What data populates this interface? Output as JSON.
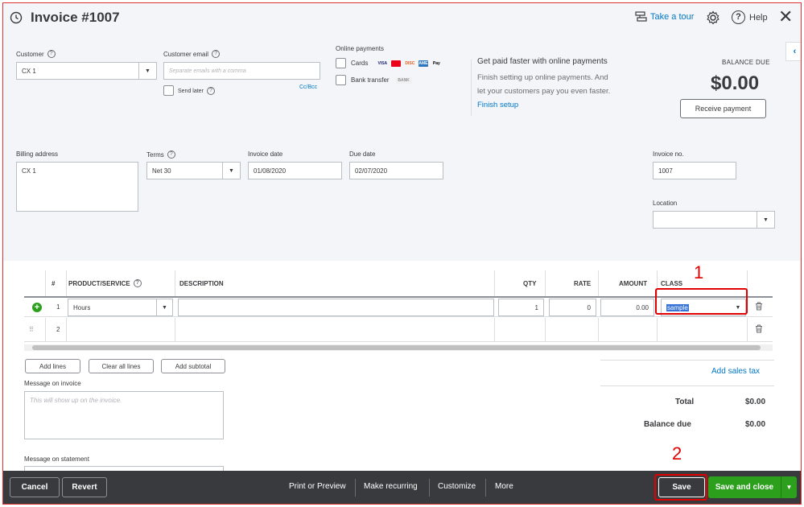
{
  "header": {
    "title": "Invoice #1007",
    "tour_label": "Take a tour",
    "help_label": "Help",
    "help_glyph": "?",
    "close_glyph": "✕"
  },
  "customer": {
    "label": "Customer",
    "value": "CX 1",
    "help_glyph": "?"
  },
  "customer_email": {
    "label": "Customer email",
    "placeholder": "Separate emails with a comma",
    "send_later": "Send later",
    "cc_bcc": "Cc/Bcc"
  },
  "online_payments": {
    "label": "Online payments",
    "cards": "Cards",
    "card_logos": [
      "VISA",
      "MC",
      "DISC",
      "AMEX",
      "Pay"
    ],
    "bank_transfer": "Bank transfer",
    "bank_badge": "BANK"
  },
  "promo": {
    "heading": "Get paid faster with online payments",
    "line1": "Finish setting up online payments. And",
    "line2": "let your customers pay you even faster.",
    "link": "Finish setup"
  },
  "balance": {
    "label": "BALANCE DUE",
    "value": "$0.00",
    "receive_button": "Receive payment"
  },
  "billing": {
    "label": "Billing address",
    "value": "CX 1"
  },
  "terms": {
    "label": "Terms",
    "value": "Net 30"
  },
  "invoice_date": {
    "label": "Invoice date",
    "value": "01/08/2020"
  },
  "due_date": {
    "label": "Due date",
    "value": "02/07/2020"
  },
  "invoice_no": {
    "label": "Invoice no.",
    "value": "1007"
  },
  "location": {
    "label": "Location",
    "value": ""
  },
  "table": {
    "headers": {
      "num": "#",
      "product": "PRODUCT/SERVICE",
      "description": "DESCRIPTION",
      "qty": "QTY",
      "rate": "RATE",
      "amount": "AMOUNT",
      "class": "CLASS"
    },
    "rows": [
      {
        "num": "1",
        "product": "Hours",
        "description": "",
        "qty": "1",
        "rate": "0",
        "amount": "0.00",
        "class": "sample"
      },
      {
        "num": "2",
        "product": "",
        "description": "",
        "qty": "",
        "rate": "",
        "amount": "",
        "class": ""
      }
    ]
  },
  "table_buttons": {
    "add_lines": "Add lines",
    "clear_all_lines": "Clear all lines",
    "add_subtotal": "Add subtotal"
  },
  "message_invoice": {
    "label": "Message on invoice",
    "placeholder": "This will show up on the invoice."
  },
  "message_statement": {
    "label": "Message on statement"
  },
  "summary": {
    "add_sales_tax": "Add sales tax",
    "total_label": "Total",
    "total_value": "$0.00",
    "balance_due_label": "Balance due",
    "balance_due_value": "$0.00"
  },
  "annotations": {
    "step1": "1",
    "step2": "2"
  },
  "footer": {
    "cancel": "Cancel",
    "revert": "Revert",
    "print_preview": "Print or Preview",
    "make_recurring": "Make recurring",
    "customize": "Customize",
    "more": "More",
    "save": "Save",
    "save_and_close": "Save and close"
  },
  "colors": {
    "accent_green": "#2ca01c",
    "link_blue": "#0077c5",
    "annotation_red": "#e00000",
    "footer_bg": "#393a3d"
  },
  "icons": [
    "history-icon",
    "tour-icon",
    "gear-icon",
    "help-icon",
    "close-icon",
    "add-line-icon",
    "trash-icon",
    "drag-handle-icon",
    "collapse-panel-icon"
  ]
}
